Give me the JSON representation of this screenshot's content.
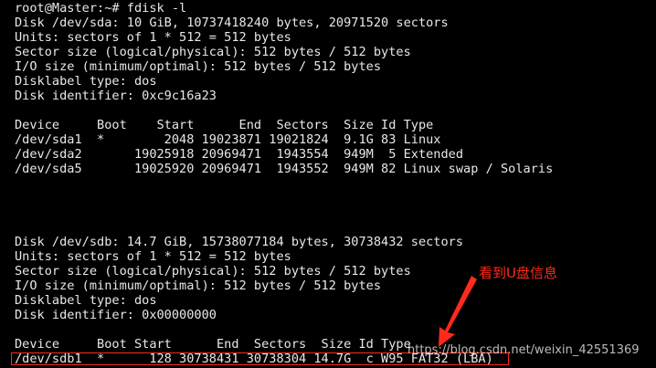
{
  "terminal": {
    "lines": [
      "root@Master:~# fdisk -l",
      "Disk /dev/sda: 10 GiB, 10737418240 bytes, 20971520 sectors",
      "Units: sectors of 1 * 512 = 512 bytes",
      "Sector size (logical/physical): 512 bytes / 512 bytes",
      "I/O size (minimum/optimal): 512 bytes / 512 bytes",
      "Disklabel type: dos",
      "Disk identifier: 0xc9c16a23",
      "",
      "Device     Boot    Start      End  Sectors  Size Id Type",
      "/dev/sda1  *        2048 19023871 19021824  9.1G 83 Linux",
      "/dev/sda2       19025918 20969471  1943554  949M  5 Extended",
      "/dev/sda5       19025920 20969471  1943552  949M 82 Linux swap / Solaris",
      "",
      "",
      "",
      "Disk /dev/sdb: 14.7 GiB, 15738077184 bytes, 30738432 sectors",
      "Units: sectors of 1 * 512 = 512 bytes",
      "Sector size (logical/physical): 512 bytes / 512 bytes",
      "I/O size (minimum/optimal): 512 bytes / 512 bytes",
      "Disklabel type: dos",
      "Disk identifier: 0x00000000",
      "",
      "Device     Boot Start      End  Sectors  Size Id Type",
      "/dev/sdb1  *      128 30738431 30738304 14.7G  c W95 FAT32 (LBA)"
    ]
  },
  "annotation": {
    "text": "看到U盘信息",
    "color": "#ff2a1a"
  },
  "watermark": {
    "text": "https://blog.csdn.net/weixin_42551369"
  }
}
